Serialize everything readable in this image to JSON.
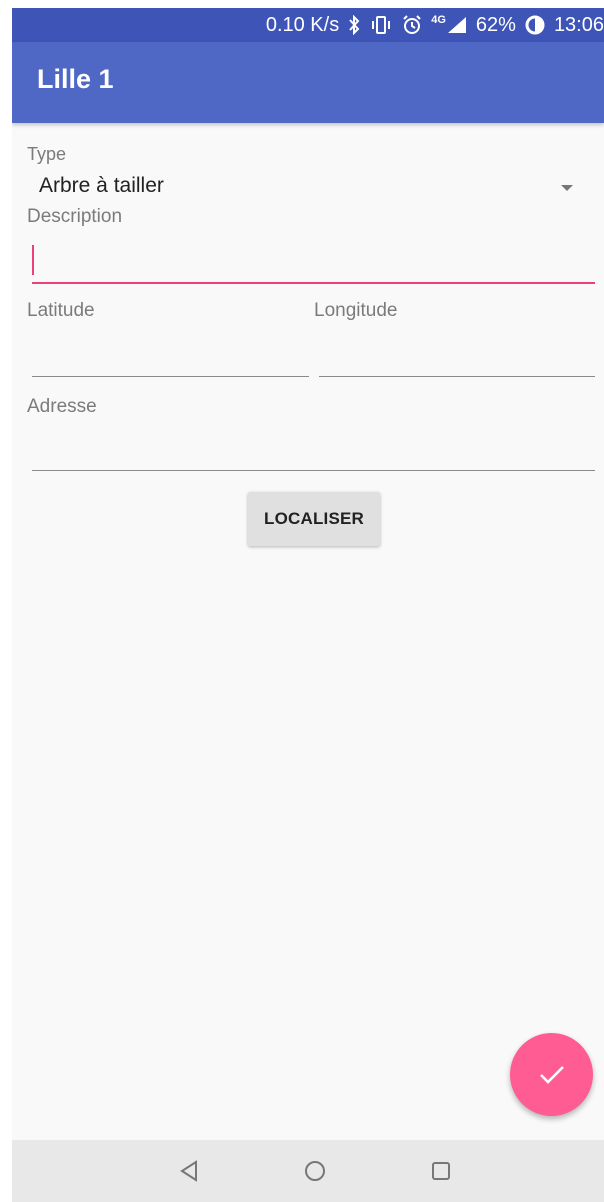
{
  "status_bar": {
    "speed": "0.10 K/s",
    "network": "4G",
    "battery": "62%",
    "time": "13:06",
    "icons": [
      "bluetooth-icon",
      "vibrate-icon",
      "alarm-icon",
      "signal-icon",
      "battery-icon"
    ]
  },
  "app_bar": {
    "title": "Lille 1"
  },
  "form": {
    "type_label": "Type",
    "type_value": "Arbre à tailler",
    "description_label": "Description",
    "description_value": "",
    "latitude_label": "Latitude",
    "latitude_value": "",
    "longitude_label": "Longitude",
    "longitude_value": "",
    "address_label": "Adresse",
    "address_value": "",
    "localize_button": "LOCALISER"
  },
  "fab": {
    "icon": "check-icon"
  },
  "nav": {
    "icons": [
      "back-icon",
      "home-icon",
      "recents-icon"
    ]
  },
  "colors": {
    "status_bar": "#3e55b7",
    "app_bar": "#5068c5",
    "accent": "#ec407a",
    "fab": "#ff5c93"
  }
}
